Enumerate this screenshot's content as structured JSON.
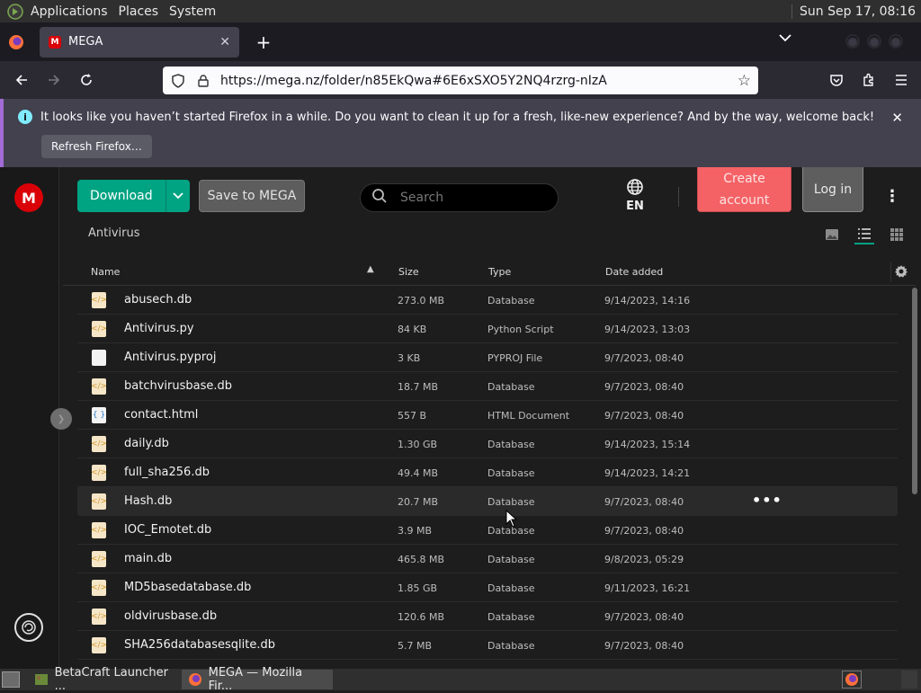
{
  "system_panel": {
    "menus": [
      "Applications",
      "Places",
      "System"
    ],
    "clock": "Sun Sep 17, 08:16"
  },
  "browser": {
    "tab": {
      "title": "MEGA",
      "favicon_letter": "M"
    },
    "url": "https://mega.nz/folder/n85EkQwa#6E6xSXO5Y2NQ4rzrg-nIzA",
    "notification": {
      "message": "It looks like you haven’t started Firefox in a while. Do you want to clean it up for a fresh, like-new experience? And by the way, welcome back!",
      "button": "Refresh Firefox…"
    }
  },
  "mega": {
    "logo_letter": "M",
    "toolbar": {
      "download_label": "Download",
      "save_label": "Save to MEGA",
      "search_placeholder": "Search",
      "language": "EN",
      "create_account_line1": "Create",
      "create_account_line2": "account",
      "login_label": "Log in"
    },
    "breadcrumb": "Antivirus",
    "table": {
      "columns": {
        "name": "Name",
        "size": "Size",
        "type": "Type",
        "date": "Date added"
      },
      "rows": [
        {
          "name": "abusech.db",
          "size": "273.0 MB",
          "type": "Database",
          "date": "9/14/2023, 14:16",
          "icon": "db"
        },
        {
          "name": "Antivirus.py",
          "size": "84 KB",
          "type": "Python Script",
          "date": "9/14/2023, 13:03",
          "icon": "py"
        },
        {
          "name": "Antivirus.pyproj",
          "size": "3 KB",
          "type": "PYPROJ File",
          "date": "9/7/2023, 08:40",
          "icon": "generic"
        },
        {
          "name": "batchvirusbase.db",
          "size": "18.7 MB",
          "type": "Database",
          "date": "9/7/2023, 08:40",
          "icon": "db"
        },
        {
          "name": "contact.html",
          "size": "557 B",
          "type": "HTML Document",
          "date": "9/7/2023, 08:40",
          "icon": "html"
        },
        {
          "name": "daily.db",
          "size": "1.30 GB",
          "type": "Database",
          "date": "9/14/2023, 15:14",
          "icon": "db"
        },
        {
          "name": "full_sha256.db",
          "size": "49.4 MB",
          "type": "Database",
          "date": "9/14/2023, 14:21",
          "icon": "db"
        },
        {
          "name": "Hash.db",
          "size": "20.7 MB",
          "type": "Database",
          "date": "9/7/2023, 08:40",
          "icon": "db"
        },
        {
          "name": "IOC_Emotet.db",
          "size": "3.9 MB",
          "type": "Database",
          "date": "9/7/2023, 08:40",
          "icon": "db"
        },
        {
          "name": "main.db",
          "size": "465.8 MB",
          "type": "Database",
          "date": "9/8/2023, 05:29",
          "icon": "db"
        },
        {
          "name": "MD5basedatabase.db",
          "size": "1.85 GB",
          "type": "Database",
          "date": "9/11/2023, 16:21",
          "icon": "db"
        },
        {
          "name": "oldvirusbase.db",
          "size": "120.6 MB",
          "type": "Database",
          "date": "9/7/2023, 08:40",
          "icon": "db"
        },
        {
          "name": "SHA256databasesqlite.db",
          "size": "5.7 MB",
          "type": "Database",
          "date": "9/7/2023, 08:40",
          "icon": "db"
        }
      ]
    }
  },
  "taskbar": {
    "tasks": [
      "BetaCraft Launcher ...",
      "MEGA — Mozilla Fir..."
    ]
  }
}
